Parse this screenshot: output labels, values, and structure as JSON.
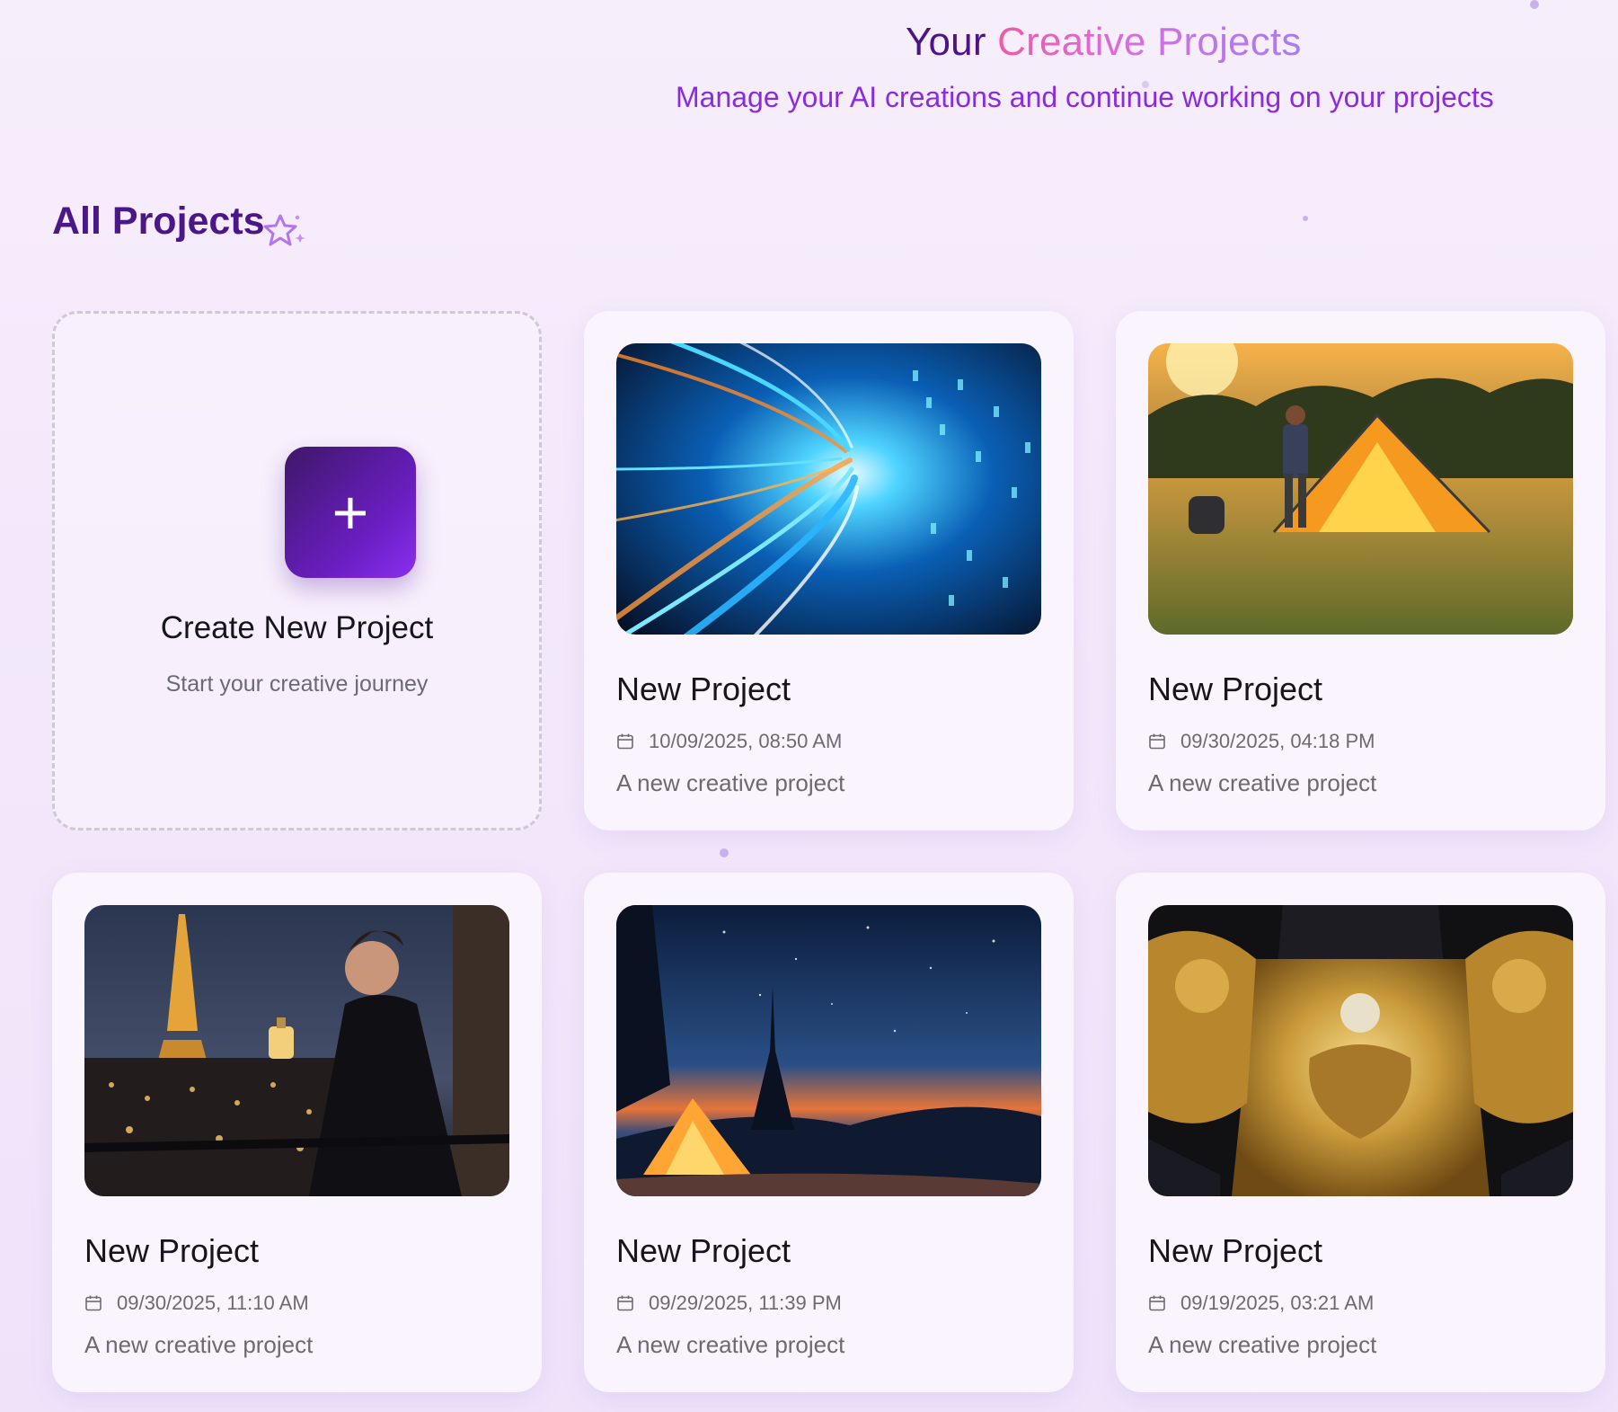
{
  "header": {
    "title_part1": "Your",
    "title_part2": "Creative Projects",
    "subtitle": "Manage your AI creations and continue working on your projects"
  },
  "section": {
    "title": "All Projects",
    "icon": "sparkle-star-icon"
  },
  "create_card": {
    "icon": "plus-icon",
    "plus_glyph": "+",
    "title": "Create New Project",
    "subtitle": "Start your creative journey"
  },
  "projects": [
    {
      "title": "New Project",
      "date": "10/09/2025, 08:50 AM",
      "description": "A new creative project",
      "thumbnail": "neon-data-tunnel"
    },
    {
      "title": "New Project",
      "date": "09/30/2025, 04:18 PM",
      "description": "A new creative project",
      "thumbnail": "camper-pitching-tent-at-sunset"
    },
    {
      "title": "New Project",
      "date": "09/30/2025, 11:10 AM",
      "description": "A new creative project",
      "thumbnail": "woman-with-perfume-eiffel-tower"
    },
    {
      "title": "New Project",
      "date": "09/29/2025, 11:39 PM",
      "description": "A new creative project",
      "thumbnail": "glowing-tent-under-starry-sky"
    },
    {
      "title": "New Project",
      "date": "09/19/2025, 03:21 AM",
      "description": "A new creative project",
      "thumbnail": "golden-dragon-armor"
    }
  ],
  "colors": {
    "accent": "#6a1ec2",
    "title_dark": "#4a1788",
    "subtitle": "#8a2be2"
  }
}
